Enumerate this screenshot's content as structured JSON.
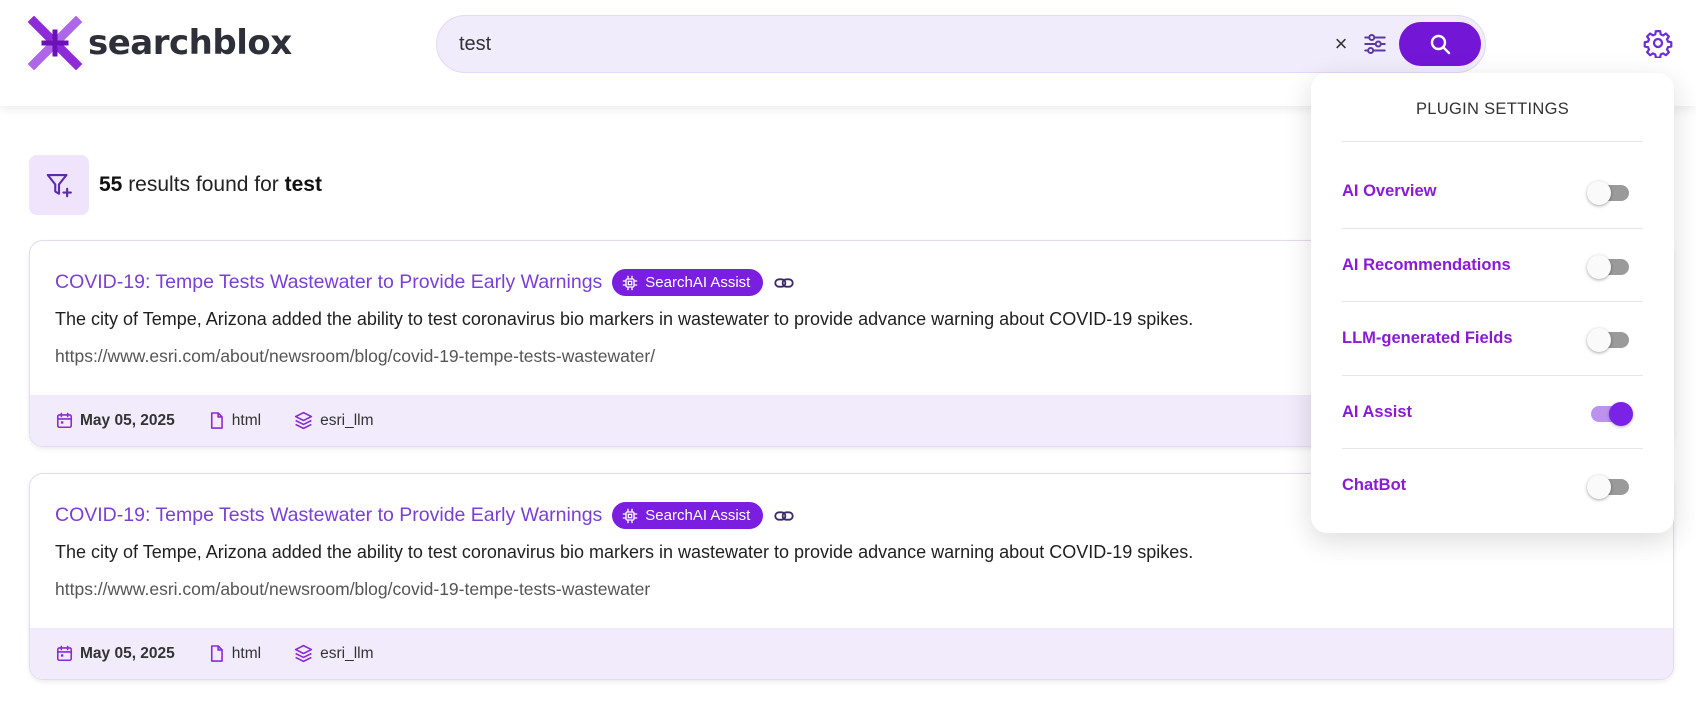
{
  "header": {
    "logo_text": "searchblox",
    "search_value": "test",
    "clear_glyph": "×"
  },
  "results": {
    "count": "55",
    "middle": " results found for ",
    "query": "test"
  },
  "cards": [
    {
      "title": "COVID-19: Tempe Tests Wastewater to Provide Early Warnings",
      "badge": "SearchAI Assist",
      "description": "The city of Tempe, Arizona added the ability to test coronavirus bio markers in wastewater to provide advance warning about COVID-19 spikes.",
      "url": "https://www.esri.com/about/newsroom/blog/covid-19-tempe-tests-wastewater/",
      "date": "May 05, 2025",
      "type": "html",
      "collection": "esri_llm"
    },
    {
      "title": "COVID-19: Tempe Tests Wastewater to Provide Early Warnings",
      "badge": "SearchAI Assist",
      "description": "The city of Tempe, Arizona added the ability to test coronavirus bio markers in wastewater to provide advance warning about COVID-19 spikes.",
      "url": "https://www.esri.com/about/newsroom/blog/covid-19-tempe-tests-wastewater",
      "date": "May 05, 2025",
      "type": "html",
      "collection": "esri_llm"
    }
  ],
  "plugin_settings": {
    "title": "PLUGIN SETTINGS",
    "items": [
      {
        "label": "AI Overview",
        "enabled": false
      },
      {
        "label": "AI Recommendations",
        "enabled": false
      },
      {
        "label": "LLM-generated Fields",
        "enabled": false
      },
      {
        "label": "AI Assist",
        "enabled": true
      },
      {
        "label": "ChatBot",
        "enabled": false
      }
    ]
  },
  "colors": {
    "brand_purple": "#7316d6",
    "title_purple": "#7b3fd6",
    "setting_label": "#8a1ad6",
    "footer_bg": "#f1ebfb"
  },
  "icons": {
    "logo": "searchblox-x-logo",
    "clear": "close-icon",
    "filters": "sliders-icon",
    "search": "search-icon",
    "settings": "gear-icon",
    "add_filter": "filter-plus-icon",
    "badge": "chip-icon",
    "link": "link-icon",
    "date": "calendar-icon",
    "type": "file-icon",
    "collection": "layers-icon"
  }
}
